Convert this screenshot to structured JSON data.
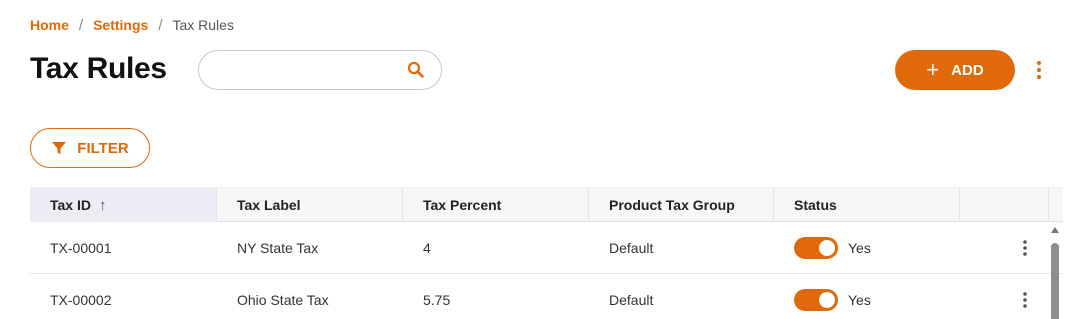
{
  "breadcrumb": {
    "home": "Home",
    "settings": "Settings",
    "current": "Tax Rules",
    "separator": "/"
  },
  "page_title": "Tax Rules",
  "search": {
    "value": "",
    "placeholder": ""
  },
  "toolbar": {
    "add_label": "ADD",
    "filter_label": "FILTER"
  },
  "colors": {
    "accent": "#e06a0a"
  },
  "table": {
    "columns": [
      "Tax ID",
      "Tax Label",
      "Tax Percent",
      "Product Tax Group",
      "Status",
      ""
    ],
    "sorted_column": "Tax ID",
    "sort_direction": "ascending",
    "rows": [
      {
        "tax_id": "TX-00001",
        "label": "NY State Tax",
        "percent": "4",
        "group": "Default",
        "status_on": true,
        "status_text": "Yes"
      },
      {
        "tax_id": "TX-00002",
        "label": "Ohio State Tax",
        "percent": "5.75",
        "group": "Default",
        "status_on": true,
        "status_text": "Yes"
      }
    ]
  }
}
